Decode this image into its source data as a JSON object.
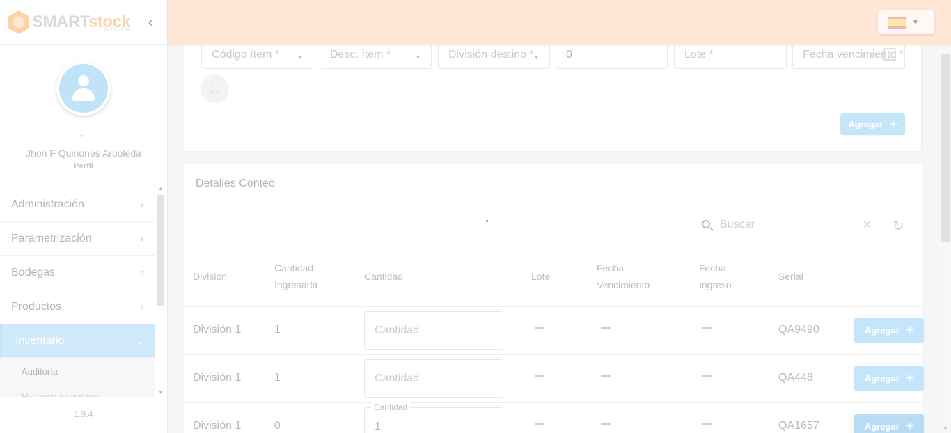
{
  "brand": {
    "smart": "SMART",
    "stock": "stock",
    "sub": "by PEGASO"
  },
  "user": {
    "name": "Jhon F Quinones Arboleda",
    "profile_label": "Perfil"
  },
  "sidebar": {
    "items": [
      {
        "label": "Administración"
      },
      {
        "label": "Parametrización"
      },
      {
        "label": "Bodegas"
      },
      {
        "label": "Productos"
      },
      {
        "label": "Inventario"
      }
    ],
    "subitems": [
      {
        "label": "Auditoría"
      },
      {
        "label": "Histórico inventario"
      }
    ],
    "version": "1.9.4"
  },
  "form": {
    "codigo_item_placeholder": "Código ítem *",
    "desc_item_placeholder": "Desc. ítem *",
    "division_destino_placeholder": "División destino *",
    "cantidad_value": "0",
    "lote_placeholder": "Lote *",
    "fecha_vencimiento_placeholder": "Fecha vencimiento *",
    "agregar_label": "Agregar"
  },
  "details": {
    "title": "Detalles Conteo",
    "search_placeholder": "Buscar",
    "columns": {
      "division": "División",
      "cantidad_ingresada_1": "Cantidad",
      "cantidad_ingresada_2": "Ingresada",
      "cantidad": "Cantidad",
      "lote": "Lote",
      "fecha_venc_1": "Fecha",
      "fecha_venc_2": "Vencimiento",
      "fecha_ingreso_1": "Fecha",
      "fecha_ingreso_2": "Ingreso",
      "serial": "Serial"
    },
    "rows": [
      {
        "division": "División 1",
        "cantidad_ingresada": "1",
        "cantidad_placeholder": "Cantidad",
        "cantidad_value": "",
        "serial": "QA9490",
        "action": "Agregar"
      },
      {
        "division": "División 1",
        "cantidad_ingresada": "1",
        "cantidad_placeholder": "Cantidad",
        "cantidad_value": "",
        "serial": "QA448",
        "action": "Agregar"
      },
      {
        "division": "División 1",
        "cantidad_ingresada": "0",
        "cantidad_label": "Cantidad",
        "cantidad_value": "1",
        "serial": "QA1657",
        "action": "Agregar"
      }
    ]
  },
  "colors": {
    "header_bg": "#ffe6d5",
    "accent_blue": "#c5e6fa",
    "active_menu": "#cfe9fb"
  }
}
